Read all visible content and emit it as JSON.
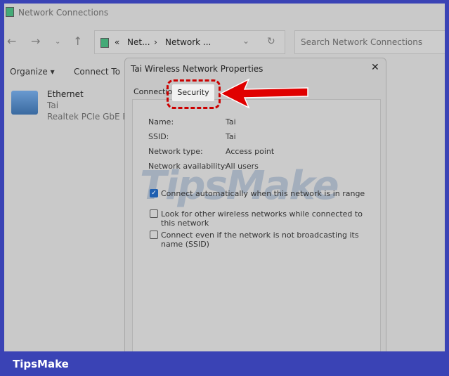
{
  "window": {
    "title": "Network Connections"
  },
  "address": {
    "prefix": "«",
    "crumb1": "Net...",
    "sep": "›",
    "crumb2": "Network ..."
  },
  "search": {
    "placeholder": "Search Network Connections"
  },
  "toolbar": {
    "organize": "Organize ▾",
    "connect_to": "Connect To"
  },
  "adapter": {
    "name": "Ethernet",
    "network": "Tai",
    "device": "Realtek PCIe GbE Fan"
  },
  "dialog": {
    "title": "Tai Wireless Network Properties",
    "close": "✕",
    "tabs": [
      {
        "label": "Connection"
      },
      {
        "label": "Security"
      }
    ],
    "fields": [
      {
        "label": "Name:",
        "value": "Tai"
      },
      {
        "label": "SSID:",
        "value": "Tai"
      },
      {
        "label": "Network type:",
        "value": "Access point"
      },
      {
        "label": "Network availability:",
        "value": "All users"
      }
    ],
    "options": [
      {
        "label": "Connect automatically when this network is in range",
        "checked": true
      },
      {
        "label": "Look for other wireless networks while connected to this network",
        "checked": false
      },
      {
        "label": "Connect even if the network is not broadcasting its name (SSID)",
        "checked": false
      }
    ]
  },
  "watermark": "TipsMake",
  "brand": "TipsMake",
  "colors": {
    "frame": "#3a43b5",
    "arrow": "#e00000",
    "check": "#1f5fb0"
  }
}
